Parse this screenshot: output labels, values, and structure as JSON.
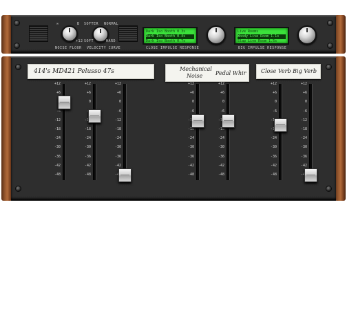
{
  "top_rack": {
    "labels": {
      "noise_floor": "NOISE FLOOR",
      "velocity_curve": "VELOCITY CURVE",
      "close_ir": "CLOSE IMPULSE RESPONSE",
      "big_ir": "BIG IMPULSE RESPONSE",
      "noise_min": "∞",
      "noise_max": "+12",
      "vel_softer": "SOFTER",
      "vel_soft": "SOFT",
      "vel_normal": "NORMAL",
      "vel_hard": "HARD",
      "vel_b": "B"
    },
    "close_ir_list": [
      "Dark Iso Booth 0.3s",
      "Dark Iso Booth 0.4s",
      "Dark Iso Booth 0.7s"
    ],
    "close_ir_selected": 1,
    "big_ir_list": [
      "Live Rooms",
      "Woody Live Room 1.1s",
      "Slap Live Room 1.5s"
    ],
    "big_ir_selected": 1
  },
  "strips": [
    {
      "text": "414's   MD421   Pelusso 47s"
    },
    {
      "text1": "Mechanical",
      "text2": "Noise",
      "text3": "Pedal Whir"
    },
    {
      "text": "Close Verb   Big Verb"
    }
  ],
  "scale": [
    "+12",
    "+6",
    "0",
    "-6",
    "-12",
    "-18",
    "-24",
    "-30",
    "-36",
    "-42",
    "-48"
  ],
  "faders": [
    {
      "id": "414s",
      "value_db": 0
    },
    {
      "id": "md421",
      "value_db": -9
    },
    {
      "id": "pelusso-47s",
      "value_db": -48
    },
    {
      "id": "mechanical-noise",
      "value_db": -12
    },
    {
      "id": "pedal-whir",
      "value_db": -12
    },
    {
      "id": "close-verb",
      "value_db": -15
    },
    {
      "id": "big-verb",
      "value_db": -48
    }
  ]
}
